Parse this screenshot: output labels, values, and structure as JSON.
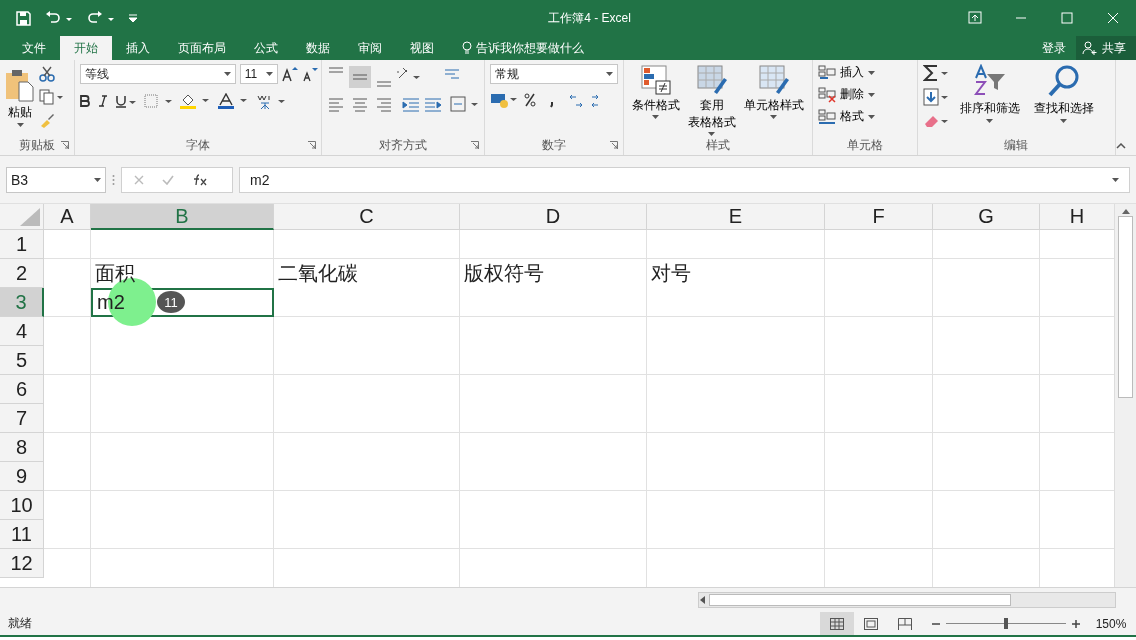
{
  "window": {
    "title": "工作簿4 - Excel"
  },
  "tabs": [
    {
      "label": "文件",
      "selected": false
    },
    {
      "label": "开始",
      "selected": true
    },
    {
      "label": "插入",
      "selected": false
    },
    {
      "label": "页面布局",
      "selected": false
    },
    {
      "label": "公式",
      "selected": false
    },
    {
      "label": "数据",
      "selected": false
    },
    {
      "label": "审阅",
      "selected": false
    },
    {
      "label": "视图",
      "selected": false
    }
  ],
  "tell_me": {
    "placeholder": "告诉我你想要做什么"
  },
  "sign_in": "登录",
  "share": "共享",
  "ribbon": {
    "clipboard": {
      "paste": "粘贴",
      "label": "剪贴板"
    },
    "font": {
      "font_name": "等线",
      "font_size": "11",
      "label": "字体"
    },
    "alignment": {
      "label": "对齐方式"
    },
    "number": {
      "format": "常规",
      "label": "数字"
    },
    "styles": {
      "buttons": [
        {
          "lines": [
            "条件格式"
          ]
        },
        {
          "lines": [
            "套用",
            "表格格式"
          ]
        },
        {
          "lines": [
            "单元格样式"
          ]
        }
      ],
      "label": "样式"
    },
    "cells": {
      "buttons": [
        "插入",
        "删除",
        "格式"
      ],
      "label": "单元格"
    },
    "editing": {
      "buttons": [
        "排序和筛选",
        "查找和选择"
      ],
      "label": "编辑"
    }
  },
  "formula_bar": {
    "name_box": "B3",
    "formula": "m2"
  },
  "columns": [
    {
      "label": "A",
      "selected": false
    },
    {
      "label": "B",
      "selected": true
    },
    {
      "label": "C",
      "selected": false
    },
    {
      "label": "D",
      "selected": false
    },
    {
      "label": "E",
      "selected": false
    },
    {
      "label": "F",
      "selected": false
    },
    {
      "label": "G",
      "selected": false
    },
    {
      "label": "H",
      "selected": false
    }
  ],
  "rows": [
    {
      "header": "1",
      "selected": false
    },
    {
      "header": "2",
      "selected": false,
      "cells": [
        null,
        "面积",
        "二氧化碳",
        "版权符号",
        "对号"
      ]
    },
    {
      "header": "3",
      "selected": true,
      "cells": [
        null,
        "m2"
      ]
    },
    {
      "header": "4",
      "selected": false
    },
    {
      "header": "5",
      "selected": false
    },
    {
      "header": "6",
      "selected": false
    },
    {
      "header": "7",
      "selected": false
    },
    {
      "header": "8",
      "selected": false
    },
    {
      "header": "9",
      "selected": false
    },
    {
      "header": "10",
      "selected": false
    },
    {
      "header": "11",
      "selected": false
    },
    {
      "header": "12",
      "selected": false
    }
  ],
  "click_marker": {
    "badge": "11"
  },
  "status_bar": {
    "status": "就绪",
    "views": [
      {
        "kind": "normal",
        "selected": true
      },
      {
        "kind": "layout",
        "selected": false
      },
      {
        "kind": "pagebreak",
        "selected": false
      }
    ],
    "zoom_slider": {
      "level": 0.5
    },
    "zoom": "150%"
  }
}
